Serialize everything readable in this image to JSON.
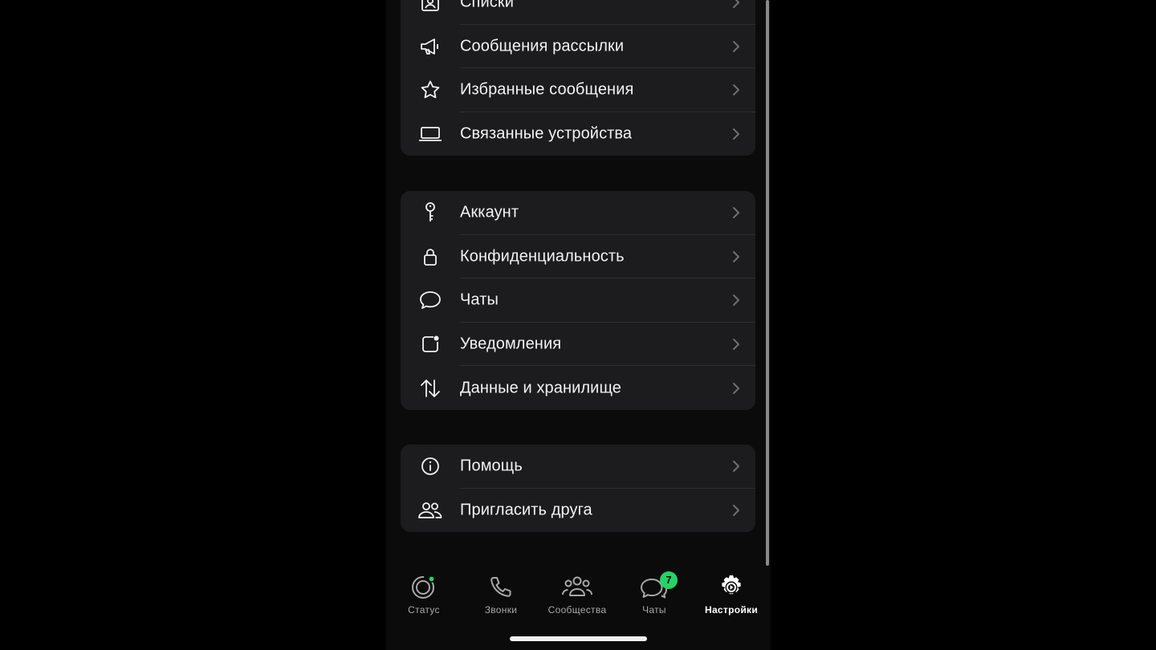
{
  "groups": [
    {
      "items": [
        {
          "label": "Списки",
          "icon": "contact-list-icon"
        },
        {
          "label": "Сообщения рассылки",
          "icon": "megaphone-icon"
        },
        {
          "label": "Избранные сообщения",
          "icon": "star-icon"
        },
        {
          "label": "Связанные устройства",
          "icon": "laptop-icon"
        }
      ]
    },
    {
      "items": [
        {
          "label": "Аккаунт",
          "icon": "key-icon"
        },
        {
          "label": "Конфиденциальность",
          "icon": "lock-icon"
        },
        {
          "label": "Чаты",
          "icon": "chat-bubble-icon"
        },
        {
          "label": "Уведомления",
          "icon": "notification-icon"
        },
        {
          "label": "Данные и хранилище",
          "icon": "up-down-arrows-icon"
        }
      ]
    },
    {
      "items": [
        {
          "label": "Помощь",
          "icon": "info-icon"
        },
        {
          "label": "Пригласить друга",
          "icon": "people-icon"
        }
      ]
    }
  ],
  "tabbar": {
    "tabs": [
      {
        "label": "Статус",
        "icon": "status-icon"
      },
      {
        "label": "Звонки",
        "icon": "phone-icon"
      },
      {
        "label": "Сообщества",
        "icon": "communities-icon"
      },
      {
        "label": "Чаты",
        "icon": "chats-icon",
        "badge": "7"
      },
      {
        "label": "Настройки",
        "icon": "settings-icon",
        "active": true
      }
    ]
  },
  "colors": {
    "accent": "#25d366",
    "background": "#0b0b0b",
    "card": "#1c1c1e"
  }
}
